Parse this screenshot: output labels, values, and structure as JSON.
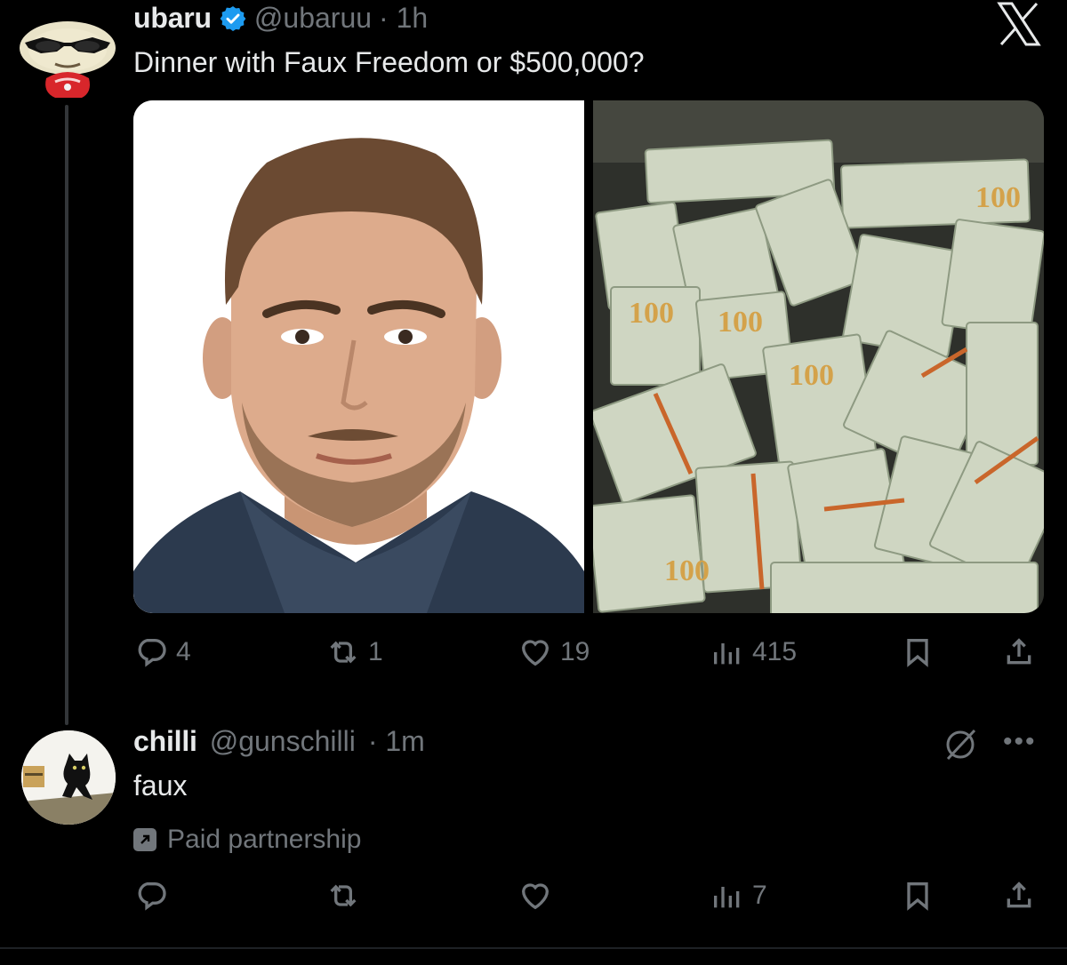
{
  "colors": {
    "background": "#000000",
    "text": "#e7e9ea",
    "muted": "#71767b",
    "verified": "#1d9bf0"
  },
  "main_post": {
    "display_name": "ubaru",
    "handle": "@ubaruu",
    "time": "· 1h",
    "text": "Dinner with Faux Freedom or $500,000?",
    "verified_icon": "verified-badge-icon",
    "avatar_icon": "cartoon-avatar-sunglasses",
    "media": [
      "portrait-photo-man",
      "photo-stacks-of-100-dollar-bills"
    ],
    "stats": {
      "replies": "4",
      "reposts": "1",
      "likes": "19",
      "views": "415"
    }
  },
  "reply": {
    "display_name": "chilli",
    "handle": "@gunschilli",
    "time": "· 1m",
    "text": "faux",
    "paid_label": "Paid partnership",
    "avatar_icon": "black-cat-avatar",
    "stats": {
      "views": "7"
    }
  },
  "icons": {
    "x_logo": "x-logo-icon",
    "reply": "reply-icon",
    "repost": "repost-icon",
    "like": "heart-icon",
    "views": "views-bar-icon",
    "bookmark": "bookmark-icon",
    "share": "share-icon",
    "hidden": "hidden-reply-icon",
    "more": "more-icon"
  }
}
